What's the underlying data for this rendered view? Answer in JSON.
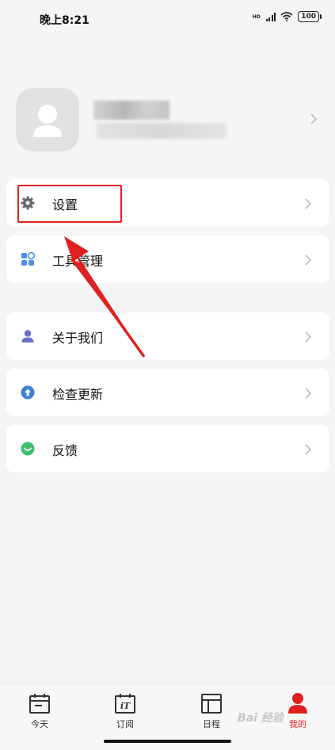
{
  "status_bar": {
    "time": "晚上8:21",
    "network": "HD",
    "battery": "100"
  },
  "profile": {
    "avatar_icon": "person-silhouette-icon"
  },
  "menu": {
    "settings": {
      "label": "设置",
      "icon": "gear-icon"
    },
    "tools": {
      "label": "工具管理",
      "icon": "grid-apps-icon"
    },
    "about": {
      "label": "关于我们",
      "icon": "person-icon"
    },
    "update": {
      "label": "检查更新",
      "icon": "arrow-up-circle-icon"
    },
    "feedback": {
      "label": "反馈",
      "icon": "smile-circle-icon"
    }
  },
  "tabbar": {
    "tabs": [
      {
        "label": "今天",
        "icon": "calendar-today-icon"
      },
      {
        "label": "订阅",
        "icon": "calendar-subscribe-icon"
      },
      {
        "label": "日程",
        "icon": "schedule-layout-icon"
      },
      {
        "label": "我的",
        "icon": "person-filled-icon"
      }
    ]
  },
  "colors": {
    "accent_red": "#e02020",
    "settings_icon": "#666666",
    "tools_icon": "#4a90e2",
    "about_icon": "#6a72c9",
    "update_icon": "#3b82d6",
    "feedback_icon": "#3fbf6f"
  },
  "watermark": "Bai 经验"
}
